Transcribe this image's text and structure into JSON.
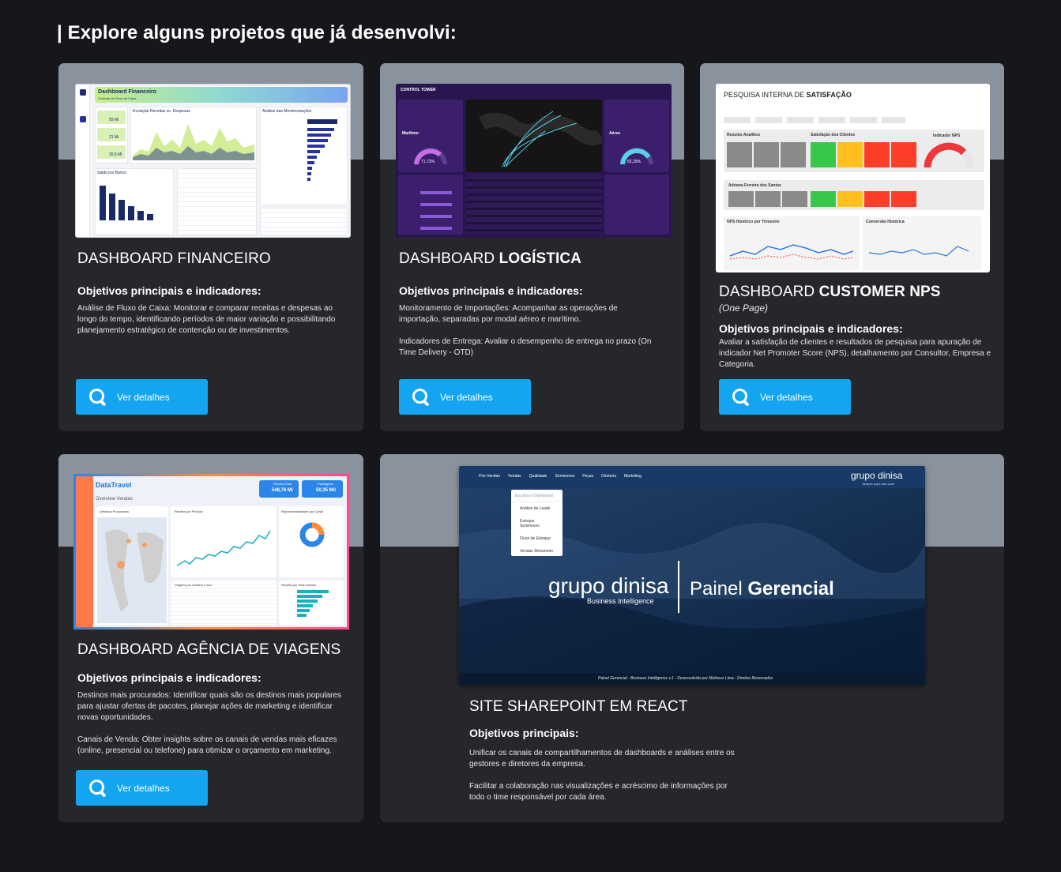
{
  "heading": "| Explore alguns projetos que já desenvolvi:",
  "projects": [
    {
      "title_light": "DASHBOARD FINANCEIRO",
      "title_bold": "",
      "objectives": "Objetivos principais e indicadores:",
      "desc1": "Análise de Fluxo de Caixa: Monitorar e comparar receitas e despesas ao longo do tempo, identificando períodos de maior variação e possibilitando planejamento estratégico de contenção ou de investimentos.",
      "button": "Ver detalhes",
      "shot": {
        "title": "Dashboard Financeiro",
        "subtitle": "Controle de Fluxo de Caixa",
        "chart_title": "Evolução Receitas vs. Despesas",
        "side_title": "Análise das Movimentações",
        "kpis": [
          {
            "label": "Receitas",
            "value": "59 Mi"
          },
          {
            "label": "Despesas",
            "value": "21 Mi"
          },
          {
            "label": "Saldo",
            "value": "20,5 Mi"
          }
        ],
        "bank_title": "Saldo por Banco"
      }
    },
    {
      "title_light": "DASHBOARD ",
      "title_bold": "LOGÍSTICA",
      "objectives": "Objetivos principais e indicadores:",
      "desc1": "Monitoramento de Importações: Acompanhar as operações de importação, separadas por modal aéreo e marítimo.",
      "desc2": "Indicadores de Entrega: Avaliar o desempenho de entrega no prazo (On Time Delivery - OTD)",
      "button": "Ver detalhes",
      "shot": {
        "title": "CONTROL TOWER",
        "left_label": "Marítimo",
        "left_gauge": "71,72%",
        "right_label": "Aéreo",
        "right_gauge": "82,29%"
      }
    },
    {
      "title_light": "DASHBOARD ",
      "title_bold": "CUSTOMER NPS",
      "subtitle": "(One Page)",
      "objectives": "Objetivos principais e indicadores:",
      "desc1": "Avaliar a satisfação de clientes e resultados de pesquisa para apuração de indicador Net Promoter Score (NPS), detalhamento por Consultor, Empresa e Categoria.",
      "button": "Ver detalhes",
      "shot": {
        "title_light": "PESQUISA INTERNA DE ",
        "title_bold": "SATISFAÇÃO",
        "resumo": "Resumo Analítico",
        "satisf": "Satisfação dos Clientes",
        "indicador": "Indicador NPS",
        "person": "Adriana Ferreira dos Santos",
        "hist": "NPS Histórico por Trimestre",
        "conv": "Conversão Histórica"
      }
    },
    {
      "title_light": "DASHBOARD AGÊNCIA DE VIAGENS",
      "title_bold": "",
      "objectives": "Objetivos principais e indicadores:",
      "desc1": "Destinos mais procurados: Identificar quais são os destinos mais populares para ajustar ofertas de pacotes, planejar ações de marketing e identificar novas oportunidades.",
      "desc2": "Canais de Venda: Obter insights sobre os canais de vendas mais eficazes (online, presencial ou telefone) para otimizar o orçamento em marketing.",
      "button": "Ver detalhes",
      "shot": {
        "brand": "DataTravel",
        "overview": "Overview Vendas",
        "kpi1_label": "Receita Total",
        "kpi1_value": "548,76 Mi",
        "kpi2_label": "Passagens",
        "kpi2_value": "50,35 Mil",
        "map_title": "Destinos Procurados",
        "line_title": "Receita por Período",
        "donut_title": "Representatividade por Canal",
        "table_title": "Viagens por Destino e Ano",
        "bars_title": "Receita por País Destino"
      }
    },
    {
      "title_light": "SITE SHAREPOINT EM REACT",
      "title_bold": "",
      "objectives": "Objetivos principais:",
      "desc1": "Unificar os canais de compartilhamentos de dashboards e análises entre os gestores e diretores da empresa.",
      "desc2": "Facilitar a colaboração nas visualizações e acréscimo de informações por todo o time responsável por cada área.",
      "shot": {
        "nav": [
          "Pós-Vendas",
          "Vendas",
          "Qualidade",
          "Seminovos",
          "Peças",
          "Diretoria",
          "Marketing"
        ],
        "logo": "grupo dinisa",
        "logo_tag": "Sempre aqui com você",
        "menu_header": "Escolha o Dashboard",
        "menu_items": [
          "Análise de Leads",
          "Estoque Seminovos",
          "Fluxo de Estoque",
          "Vendas Showroom"
        ],
        "hero_logo": "grupo dinisa",
        "hero_sub": "Business Intelligence",
        "hero_light": "Painel ",
        "hero_bold": "Gerencial",
        "footer": "Painel Gerencial - Business Intelligence v.1 - Desenvolvido por Matheus Lima - Direitos Reservados"
      }
    }
  ]
}
